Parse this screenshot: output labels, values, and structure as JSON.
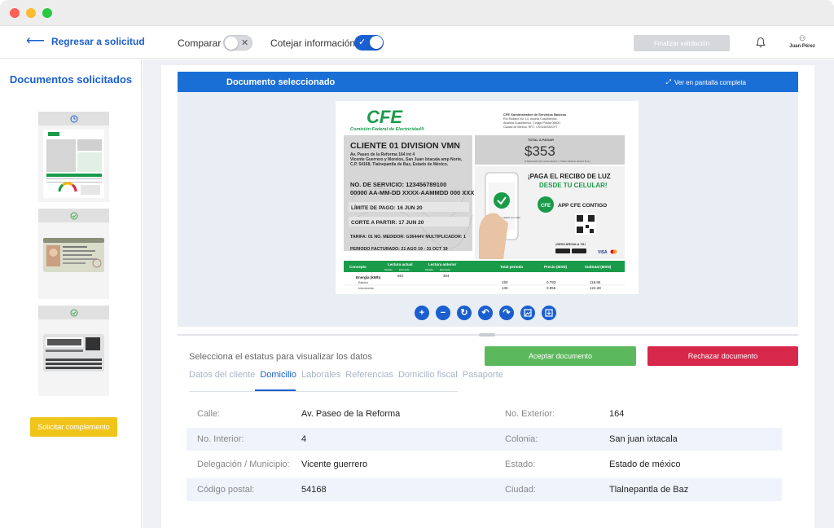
{
  "header": {
    "back_label": "Regresar a solicitud",
    "compare_label": "Comparar",
    "cross_check_label": "Cotejar información",
    "finalize_label": "Finalizar validación",
    "user_name": "Juan Pérez"
  },
  "sidebar": {
    "title": "Documentos solicitados",
    "documents": [
      {
        "kind": "cfe-bill",
        "status": "in-review"
      },
      {
        "kind": "ine-front",
        "status": "approved"
      },
      {
        "kind": "ine-back",
        "status": "approved"
      }
    ],
    "supplement_label": "Solicitar complemento"
  },
  "viewer": {
    "title": "Documento seleccionado",
    "fullscreen_label": "Ver en pantalla completa",
    "tools": [
      "zoom-in",
      "zoom-out",
      "rotate",
      "undo",
      "redo",
      "fit-image",
      "download"
    ]
  },
  "bill": {
    "logo": "CFE",
    "logo_sub": "Comisión Federal de Electricidad®",
    "issuer_lines": [
      "CFE Suministrador de Servicios Básicos",
      "Río Ródano No. 14, colonia Cuauhtémoc,",
      "Alcaldía Cuauhtémoc, Código Postal 06600,",
      "Ciudad de México. RFC: CSS160330CP7"
    ],
    "client": "CLIENTE 01 DIVISION VMN",
    "address_lines": [
      "Av. Paseo de la Reforma 164 int 4",
      "Vicente Guerrero y Morelos, San Juan Ixtacala amp Norte,",
      "C.P. 54168, Tlalnepantla de Baz, Estado de México."
    ],
    "service_no": "NO. DE SERVICIO: 123456789100",
    "meter_line": "00000 AA-MM-DD XXXX-AAMMDD 000 XXX",
    "due": "LÍMITE DE PAGO: 16 JUN 20",
    "cut": "CORTE A PARTIR: 17 JUN 20",
    "tariff": "TARIFA: 01 NO. MEDIDOR: G36444V MULTIPLICADOR: 1",
    "period": "PERIODO FACTURADO: 21 AGO 19 - 31 OCT 19",
    "total_label": "TOTAL A PAGAR",
    "total": "$353",
    "total_words": "(TRESCIENTOS CINCUENTA Y TRES PESOS 00/100 M.N.)",
    "promo_1": "¡PAGA EL RECIBO DE LUZ",
    "promo_2": "DESDE TU CELULAR!",
    "app": "APP CFE CONTIGO",
    "download": "¡DESCÁRGALA YA!",
    "phone_text": "¡El pago se realizó con éxito!",
    "cards": "VISA",
    "table_head": [
      "Concepto",
      "Lectura actual",
      "Lectura anterior",
      "Total periodo",
      "Precio (MXN)",
      "Subtotal (MXN)"
    ],
    "sub_head": [
      "Medida",
      "Estimada",
      "Medida",
      "Estimada"
    ],
    "rows": [
      [
        "Energía (kWh)",
        "657",
        "304",
        "",
        "",
        ""
      ],
      [
        "Básico",
        "",
        "",
        "150",
        "0.793",
        "118.95"
      ],
      [
        "Intermedio",
        "",
        "",
        "130",
        "0.956",
        "124.28"
      ],
      [
        "",
        "",
        "",
        "",
        "",
        ""
      ]
    ]
  },
  "details": {
    "status_hint": "Selecciona el estatus para visualizar los datos",
    "accept_label": "Aceptar documento",
    "reject_label": "Rechazar documento",
    "tabs": [
      "Datos del cliente",
      "Domicilio",
      "Laborales",
      "Referencias",
      "Domicilio fiscal",
      "Pasaporte"
    ],
    "active_tab": "Domicilio",
    "rows": [
      {
        "l1": "Calle:",
        "v1": "Av. Paseo de la Reforma",
        "l2": "No. Exterior:",
        "v2": "164"
      },
      {
        "l1": "No. Interior:",
        "v1": "4",
        "l2": "Colonia:",
        "v2": "San juan ixtacala"
      },
      {
        "l1": "Delegación / Municipio:",
        "v1": "Vicente guerrero",
        "l2": "Estado:",
        "v2": "Estado de méxico"
      },
      {
        "l1": "Código postal:",
        "v1": "54168",
        "l2": "Ciudad:",
        "v2": "Tlalnepantla de Baz"
      }
    ]
  },
  "colors": {
    "primary": "#1a5fd0",
    "accept": "#5cb85c",
    "reject": "#d7274a",
    "supplement": "#f0c419",
    "cfe_green": "#1a9b4a"
  }
}
